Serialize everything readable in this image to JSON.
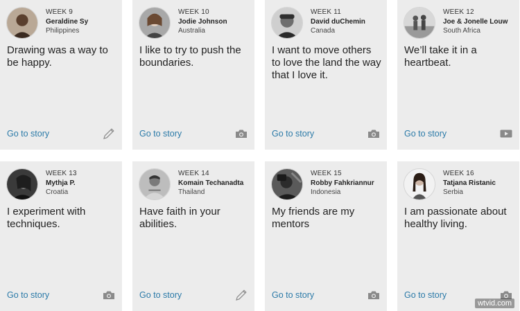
{
  "cards": [
    {
      "week": "WEEK 9",
      "name": "Geraldine Sy",
      "country": "Philippines",
      "quote": "Drawing was a way to be happy.",
      "link": "Go to story",
      "icon": "pencil-icon"
    },
    {
      "week": "WEEK 10",
      "name": "Jodie Johnson",
      "country": "Australia",
      "quote": "I like to try to push the boundaries.",
      "link": "Go to story",
      "icon": "camera-icon"
    },
    {
      "week": "WEEK 11",
      "name": "David duChemin",
      "country": "Canada",
      "quote": "I want to move others to love the land the way that I love it.",
      "link": "Go to story",
      "icon": "camera-icon"
    },
    {
      "week": "WEEK 12",
      "name": "Joe & Jonelle Louw",
      "country": "South Africa",
      "quote": "We’ll take it in a heartbeat.",
      "link": "Go to story",
      "icon": "video-play-icon"
    },
    {
      "week": "WEEK 13",
      "name": "Mythja P.",
      "country": "Croatia",
      "quote": "I experiment with techniques.",
      "link": "Go to story",
      "icon": "camera-icon"
    },
    {
      "week": "WEEK 14",
      "name": "Komain Techanadta",
      "country": "Thailand",
      "quote": "Have faith in your abilities.",
      "link": "Go to story",
      "icon": "pencil-icon"
    },
    {
      "week": "WEEK 15",
      "name": "Robby Fahkriannur",
      "country": "Indonesia",
      "quote": "My friends are my mentors",
      "link": "Go to story",
      "icon": "camera-icon"
    },
    {
      "week": "WEEK 16",
      "name": "Tatjana Ristanic",
      "country": "Serbia",
      "quote": "I am passionate about healthy living.",
      "link": "Go to story",
      "icon": "camera-icon"
    }
  ],
  "watermark": "wtvid.com",
  "colors": {
    "card_bg": "#ececec",
    "link": "#2b7aa8",
    "icon": "#8a8a8a"
  }
}
